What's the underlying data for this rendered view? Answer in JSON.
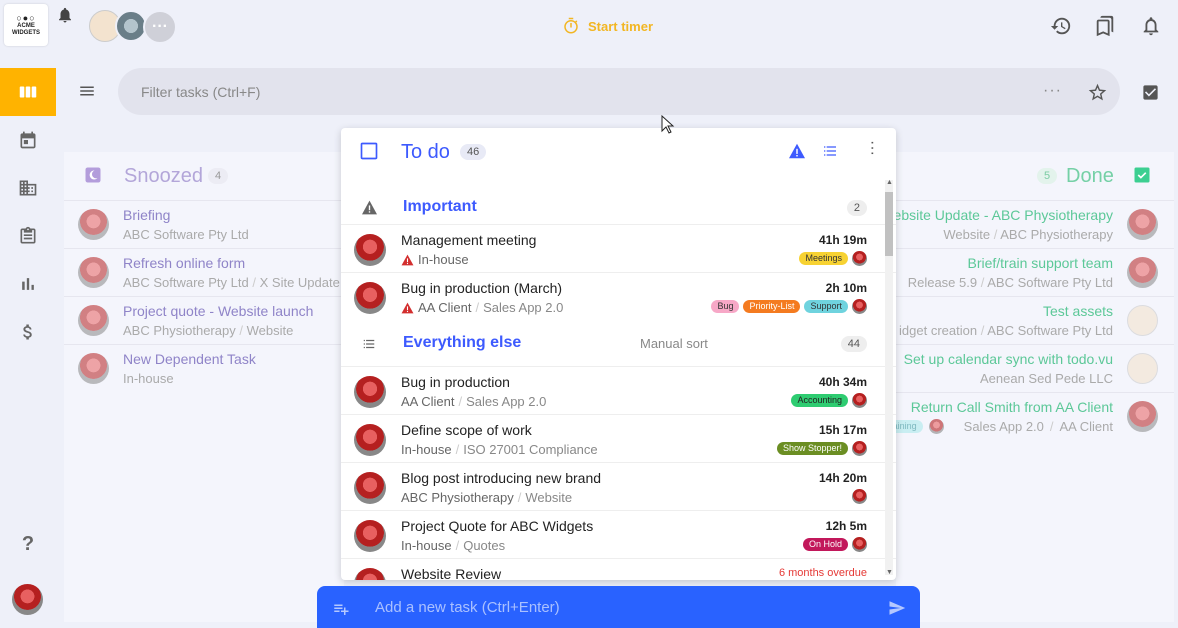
{
  "brand": {
    "logo_line1": "ACME",
    "logo_line2": "WIDGETS"
  },
  "topbar": {
    "timer_label": "Start timer"
  },
  "filter": {
    "placeholder": "Filter tasks (Ctrl+F)"
  },
  "snoozed": {
    "title": "Snoozed",
    "count": "4",
    "items": [
      {
        "title": "Briefing",
        "sub1": "ABC Software Pty Ltd",
        "sub2": ""
      },
      {
        "title": "Refresh online form",
        "sub1": "ABC Software Pty Ltd",
        "sub2": "X Site Update"
      },
      {
        "title": "Project quote - Website launch",
        "sub1": "ABC Physiotherapy",
        "sub2": "Website"
      },
      {
        "title": "New Dependent Task",
        "sub1": "In-house",
        "sub2": ""
      }
    ]
  },
  "done": {
    "title": "Done",
    "count": "5",
    "items": [
      {
        "title": "Website Update - ABC Physiotherapy",
        "sub1": "Website",
        "sub2": "ABC Physiotherapy"
      },
      {
        "title": "Brief/train support team",
        "sub1": "Release 5.9",
        "sub2": "ABC Software Pty Ltd"
      },
      {
        "title": "Test assets",
        "sub1": "idget creation",
        "sub2": "ABC Software Pty Ltd"
      },
      {
        "title": "Set up calendar sync with todo.vu",
        "sub1": "",
        "sub2": "Aenean Sed Pede LLC"
      },
      {
        "title": "Return Call Smith from AA Client",
        "sub1": "Sales App 2.0",
        "sub2": "AA Client",
        "tag": "aining"
      }
    ]
  },
  "todo": {
    "title": "To do",
    "count": "46",
    "important": {
      "label": "Important",
      "count": "2",
      "tasks": [
        {
          "title": "Management meeting",
          "sub1": "In-house",
          "sub2": "",
          "duration": "41h 19m",
          "tags": [
            {
              "label": "Meetings",
              "bg": "#f7d232",
              "fg": "#333"
            }
          ]
        },
        {
          "title": "Bug in production (March)",
          "sub1": "AA Client",
          "sub2": "Sales App 2.0",
          "duration": "2h 10m",
          "tags": [
            {
              "label": "Bug",
              "bg": "#f7a8c7",
              "fg": "#333"
            },
            {
              "label": "Priority-List",
              "bg": "#f47b20",
              "fg": "#fff"
            },
            {
              "label": "Support",
              "bg": "#6fd3de",
              "fg": "#333"
            }
          ]
        }
      ]
    },
    "else": {
      "label": "Everything else",
      "sort": "Manual sort",
      "count": "44",
      "tasks": [
        {
          "title": "Bug in production",
          "sub1": "AA Client",
          "sub2": "Sales App 2.0",
          "duration": "40h 34m",
          "tags": [
            {
              "label": "Accounting",
              "bg": "#2ecc71",
              "fg": "#222"
            }
          ]
        },
        {
          "title": "Define scope of work",
          "sub1": "In-house",
          "sub2": "ISO 27001 Compliance",
          "duration": "15h 17m",
          "tags": [
            {
              "label": "Show Stopper!",
              "bg": "#6b8e23",
              "fg": "#fff"
            }
          ]
        },
        {
          "title": "Blog post introducing new brand",
          "sub1": "ABC Physiotherapy",
          "sub2": "Website",
          "duration": "14h 20m",
          "tags": []
        },
        {
          "title": "Project Quote for ABC Widgets",
          "sub1": "In-house",
          "sub2": "Quotes",
          "duration": "12h 5m",
          "tags": [
            {
              "label": "On Hold",
              "bg": "#c2185b",
              "fg": "#fff"
            }
          ]
        }
      ],
      "partial": {
        "title": "Website Review",
        "note": "6 months overdue"
      }
    }
  },
  "addtask": {
    "placeholder": "Add a new task (Ctrl+Enter)"
  },
  "help": "?",
  "sep": "/"
}
